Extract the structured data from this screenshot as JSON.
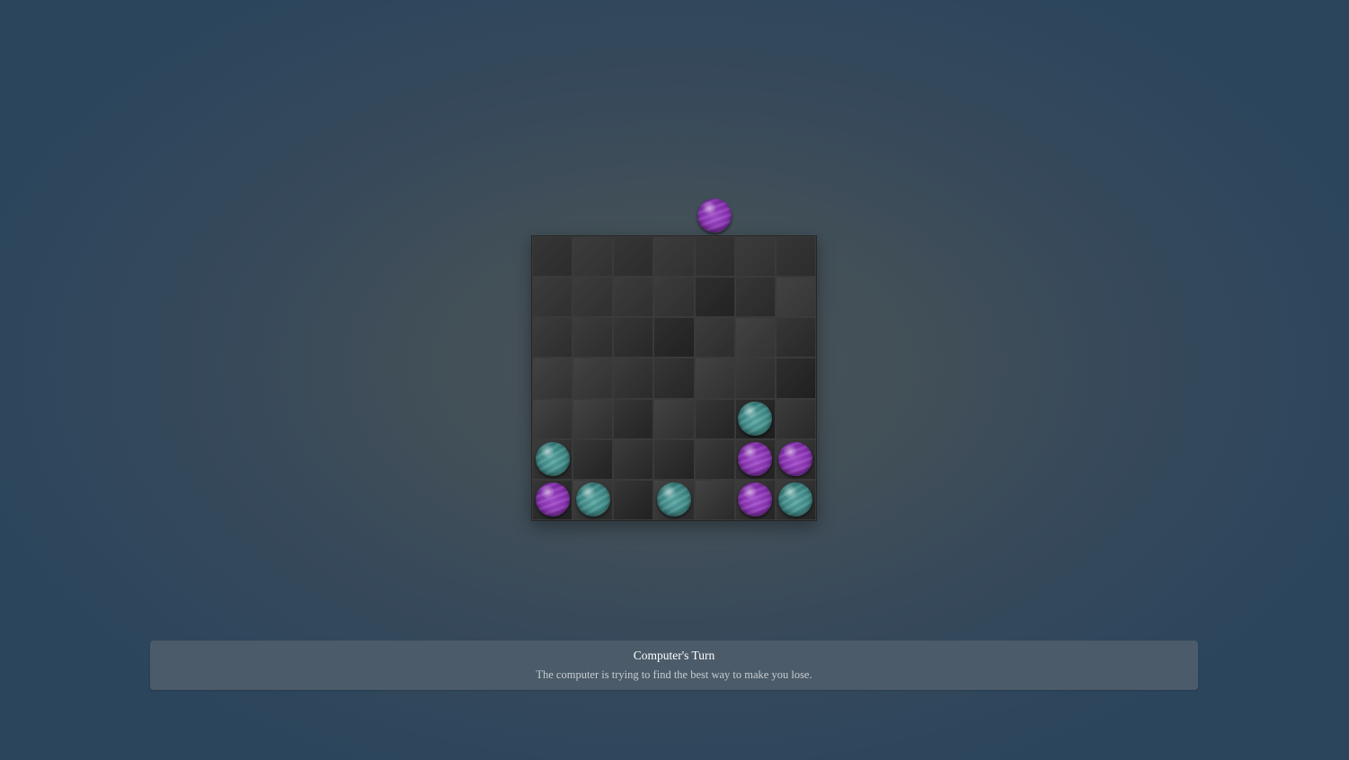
{
  "game": {
    "columns": 7,
    "rows": 7,
    "hover": {
      "column": 4,
      "player": "purple"
    },
    "board": [
      [
        "",
        "",
        "",
        "",
        "",
        "",
        ""
      ],
      [
        "",
        "",
        "",
        "",
        "",
        "",
        ""
      ],
      [
        "",
        "",
        "",
        "",
        "",
        "",
        ""
      ],
      [
        "",
        "",
        "",
        "",
        "",
        "",
        ""
      ],
      [
        "",
        "",
        "",
        "",
        "",
        "teal",
        ""
      ],
      [
        "teal",
        "",
        "",
        "",
        "",
        "purple",
        "purple"
      ],
      [
        "purple",
        "teal",
        "",
        "teal",
        "",
        "purple",
        "teal"
      ]
    ],
    "colors": {
      "purple": "#8a33b4",
      "teal": "#3f8b88",
      "cell_shades": [
        "#2e2e2e",
        "#343434",
        "#3b3b3b",
        "#262626",
        "#1f1f1f"
      ]
    }
  },
  "status": {
    "title": "Computer's Turn",
    "message": "The computer is trying to find the best way to make you lose."
  }
}
